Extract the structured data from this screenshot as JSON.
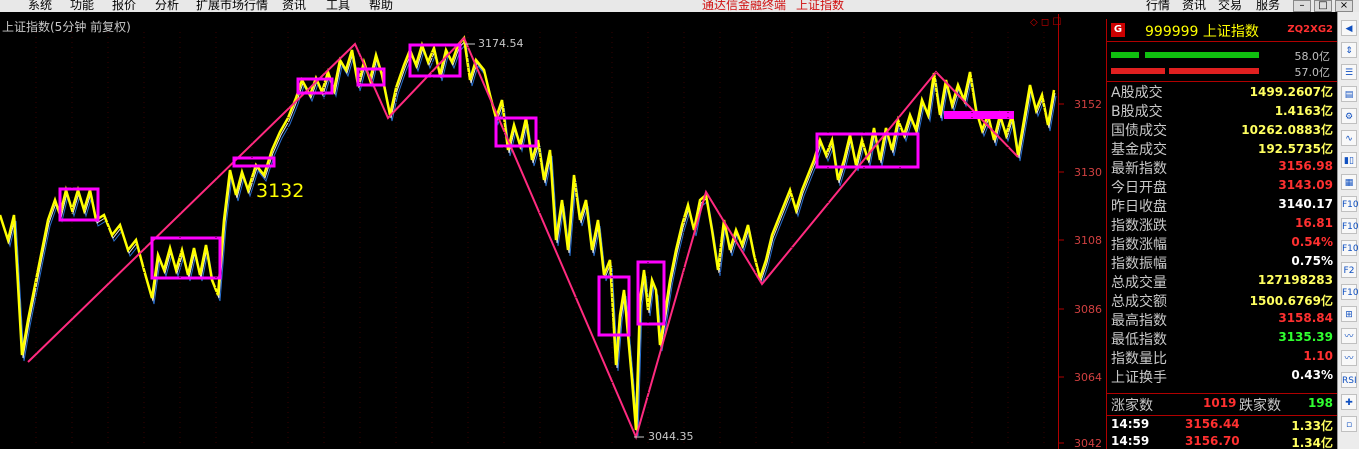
{
  "menu": {
    "items": [
      "系统",
      "功能",
      "报价",
      "扩展市场行情",
      "资讯",
      "工具",
      "帮助"
    ],
    "app_title": "通达信金融终端",
    "app_subtitle": "上证指数",
    "right_buttons": [
      "行情",
      "资讯",
      "交易",
      "服务"
    ],
    "window_buttons": [
      "–",
      "□",
      "×"
    ]
  },
  "chart": {
    "title": "上证指数(5分钟 前复权)",
    "annotation_high": "3174.54",
    "annotation_low": "3044.35",
    "annotation_label": "3132",
    "corner_icons": "◇ ◻ ☐",
    "line_color": "#ffff00",
    "trend_color": "#ff2a7f",
    "box_color": "#ff00ff",
    "y_ticks": [
      "3152",
      "3130",
      "3108",
      "3086",
      "3064",
      "3042"
    ]
  },
  "chart_data": {
    "type": "line",
    "title": "上证指数(5分钟 前复权)",
    "y_ticks": [
      3152,
      3130,
      3108,
      3086,
      3064,
      3042
    ],
    "ylim": [
      3042,
      3174.54
    ],
    "high": 3174.54,
    "low": 3044.35
  },
  "panel": {
    "badge": "G",
    "code_name": "999999 上证指数",
    "mark": "ZQ2XG2",
    "bar_values": [
      "58.0亿",
      "57.0亿"
    ],
    "bar_colors": [
      "#10c010",
      "#e02020"
    ],
    "stats": [
      {
        "label": "A股成交",
        "value": "1499.2607亿",
        "color": "#ffff60"
      },
      {
        "label": "B股成交",
        "value": "1.4163亿",
        "color": "#ffff60"
      },
      {
        "label": "国债成交",
        "value": "10262.0883亿",
        "color": "#ffff60"
      },
      {
        "label": "基金成交",
        "value": "192.5735亿",
        "color": "#ffff60"
      },
      {
        "label": "最新指数",
        "value": "3156.98",
        "color": "#ff3030"
      },
      {
        "label": "今日开盘",
        "value": "3143.09",
        "color": "#ff3030"
      },
      {
        "label": "昨日收盘",
        "value": "3140.17",
        "color": "#ffffff"
      },
      {
        "label": "指数涨跌",
        "value": "16.81",
        "color": "#ff3030"
      },
      {
        "label": "指数涨幅",
        "value": "0.54%",
        "color": "#ff3030"
      },
      {
        "label": "指数振幅",
        "value": "0.75%",
        "color": "#ffffff"
      },
      {
        "label": "总成交量",
        "value": "127198283",
        "color": "#ffff60"
      },
      {
        "label": "总成交额",
        "value": "1500.6769亿",
        "color": "#ffff60"
      },
      {
        "label": "最高指数",
        "value": "3158.84",
        "color": "#ff3030"
      },
      {
        "label": "最低指数",
        "value": "3135.39",
        "color": "#30ff30"
      },
      {
        "label": "指数量比",
        "value": "1.10",
        "color": "#ff3030"
      },
      {
        "label": "上证换手",
        "value": "0.43%",
        "color": "#ffffff"
      }
    ],
    "advance_label": "涨家数",
    "advance_value": "1019",
    "decline_label": "跌家数",
    "decline_value": "198",
    "ticks": [
      {
        "time": "14:59",
        "price": "3156.44",
        "amount": "1.33亿"
      },
      {
        "time": "14:59",
        "price": "3156.70",
        "amount": "1.34亿"
      }
    ]
  },
  "sidebar": {
    "icons": [
      "◀",
      "⇕",
      "☰",
      "▤",
      "⚙",
      "∿",
      "▮▯",
      "▦",
      "F10",
      "F10",
      "F10",
      "F2",
      "F10",
      "⊞",
      "〰",
      "〰",
      "RSI",
      "✚",
      "▫"
    ]
  }
}
